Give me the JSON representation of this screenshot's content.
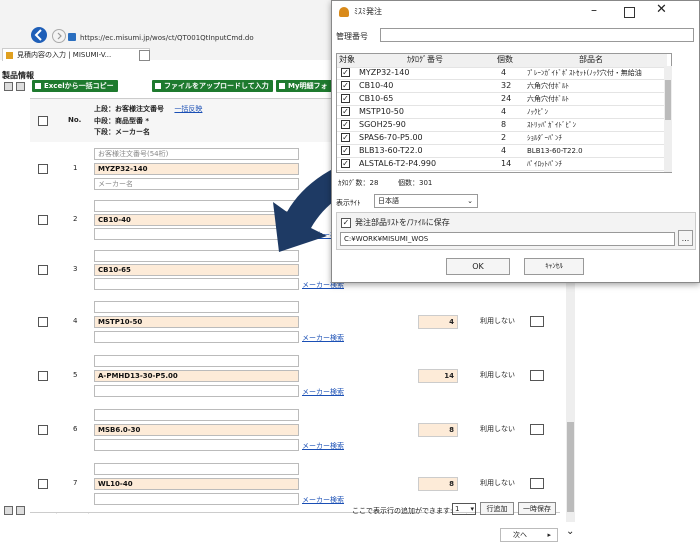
{
  "browser": {
    "url": "https://ec.misumi.jp/wos/ct/QT001QtInputCmd.do",
    "tab_label": "見積内容の入力 | MISUMI-V...",
    "section_title": "製品情報",
    "buttons": [
      "Excelから一括コピー",
      "ファイルをアップロードして入力",
      "My明細フォ"
    ],
    "header": {
      "no_label": "No.",
      "line1": "上段：お客様注文番号",
      "line1_link": "一括反映",
      "line2": "中段：商品型番 *",
      "line3": "下段：メーカー名"
    },
    "first_row": {
      "placeholder_order": "お客様注文番号(54桁)",
      "placeholder_maker": "メーカー名"
    },
    "maker_link_label": "メーカー検索",
    "rows": [
      {
        "no": "1",
        "part": "MYZP32-140",
        "qty": "",
        "usage": ""
      },
      {
        "no": "2",
        "part": "CB10-40",
        "qty": "",
        "usage": ""
      },
      {
        "no": "3",
        "part": "CB10-65",
        "qty": "",
        "usage": ""
      },
      {
        "no": "4",
        "part": "MSTP10-50",
        "qty": "4",
        "usage": "利用しない"
      },
      {
        "no": "5",
        "part": "A-PMHD13-30-P5.00",
        "qty": "14",
        "usage": "利用しない"
      },
      {
        "no": "6",
        "part": "MSB6.0-30",
        "qty": "8",
        "usage": "利用しない"
      },
      {
        "no": "7",
        "part": "WL10-40",
        "qty": "8",
        "usage": "利用しない"
      }
    ],
    "footer": {
      "add_hint": "ここで表示行の追加ができます:",
      "add_count": "1",
      "add_row_button": "行追加",
      "save_all_button": "一時保存",
      "next_button": "次へ"
    },
    "colors": {
      "accent_green": "#1e7a2e",
      "peach": "#fdebd8",
      "link_blue": "#1a4fb5",
      "arrow_navy": "#1e3a64"
    }
  },
  "dialog": {
    "title": "ﾐｽﾐ発注",
    "mgmt_label": "管理番号",
    "mgmt_value": "",
    "columns": [
      "対象",
      "ｶﾀﾛｸﾞ番号",
      "個数",
      "部品名"
    ],
    "items": [
      {
        "checked": true,
        "code": "MYZP32-140",
        "qty": "4",
        "name": "ﾌﾟﾚｰﾝｶﾞｲﾄﾞﾎﾟｽﾄｾｯﾄ(ﾉｯｸ穴付・無給油"
      },
      {
        "checked": true,
        "code": "CB10-40",
        "qty": "32",
        "name": "六角穴付ﾎﾞﾙﾄ"
      },
      {
        "checked": true,
        "code": "CB10-65",
        "qty": "24",
        "name": "六角穴付ﾎﾞﾙﾄ"
      },
      {
        "checked": true,
        "code": "MSTP10-50",
        "qty": "4",
        "name": "ﾉｯｸﾋﾟﾝ"
      },
      {
        "checked": true,
        "code": "SGOH25-90",
        "qty": "8",
        "name": "ｽﾄﾘｯﾊﾟｶﾞｲﾄﾞﾋﾟﾝ"
      },
      {
        "checked": true,
        "code": "SPAS6-70-P5.00",
        "qty": "2",
        "name": "ｼｮﾙﾀﾞｰﾊﾟﾝﾁ"
      },
      {
        "checked": true,
        "code": "BLB13-60-T22.0",
        "qty": "4",
        "name": "BLB13-60-T22.0"
      },
      {
        "checked": true,
        "code": "ALSTAL6-T2-P4.990",
        "qty": "14",
        "name": "ﾊﾟｲﾛｯﾄﾊﾟﾝﾁ"
      }
    ],
    "catalog_count_label": "ｶﾀﾛｸﾞ数：28",
    "qty_count_label": "個数：301",
    "lang_label": "表示ｻｲﾄ",
    "lang_value": "日本語",
    "save_checkbox_label": "発注部品ﾘｽﾄを/ﾌｧｲﾙに保存",
    "save_checked": true,
    "path_value": "C:¥WORK¥MISUMI_WOS",
    "browse_label": "...",
    "ok_label": "OK",
    "cancel_label": "ｷｬﾝｾﾙ"
  }
}
